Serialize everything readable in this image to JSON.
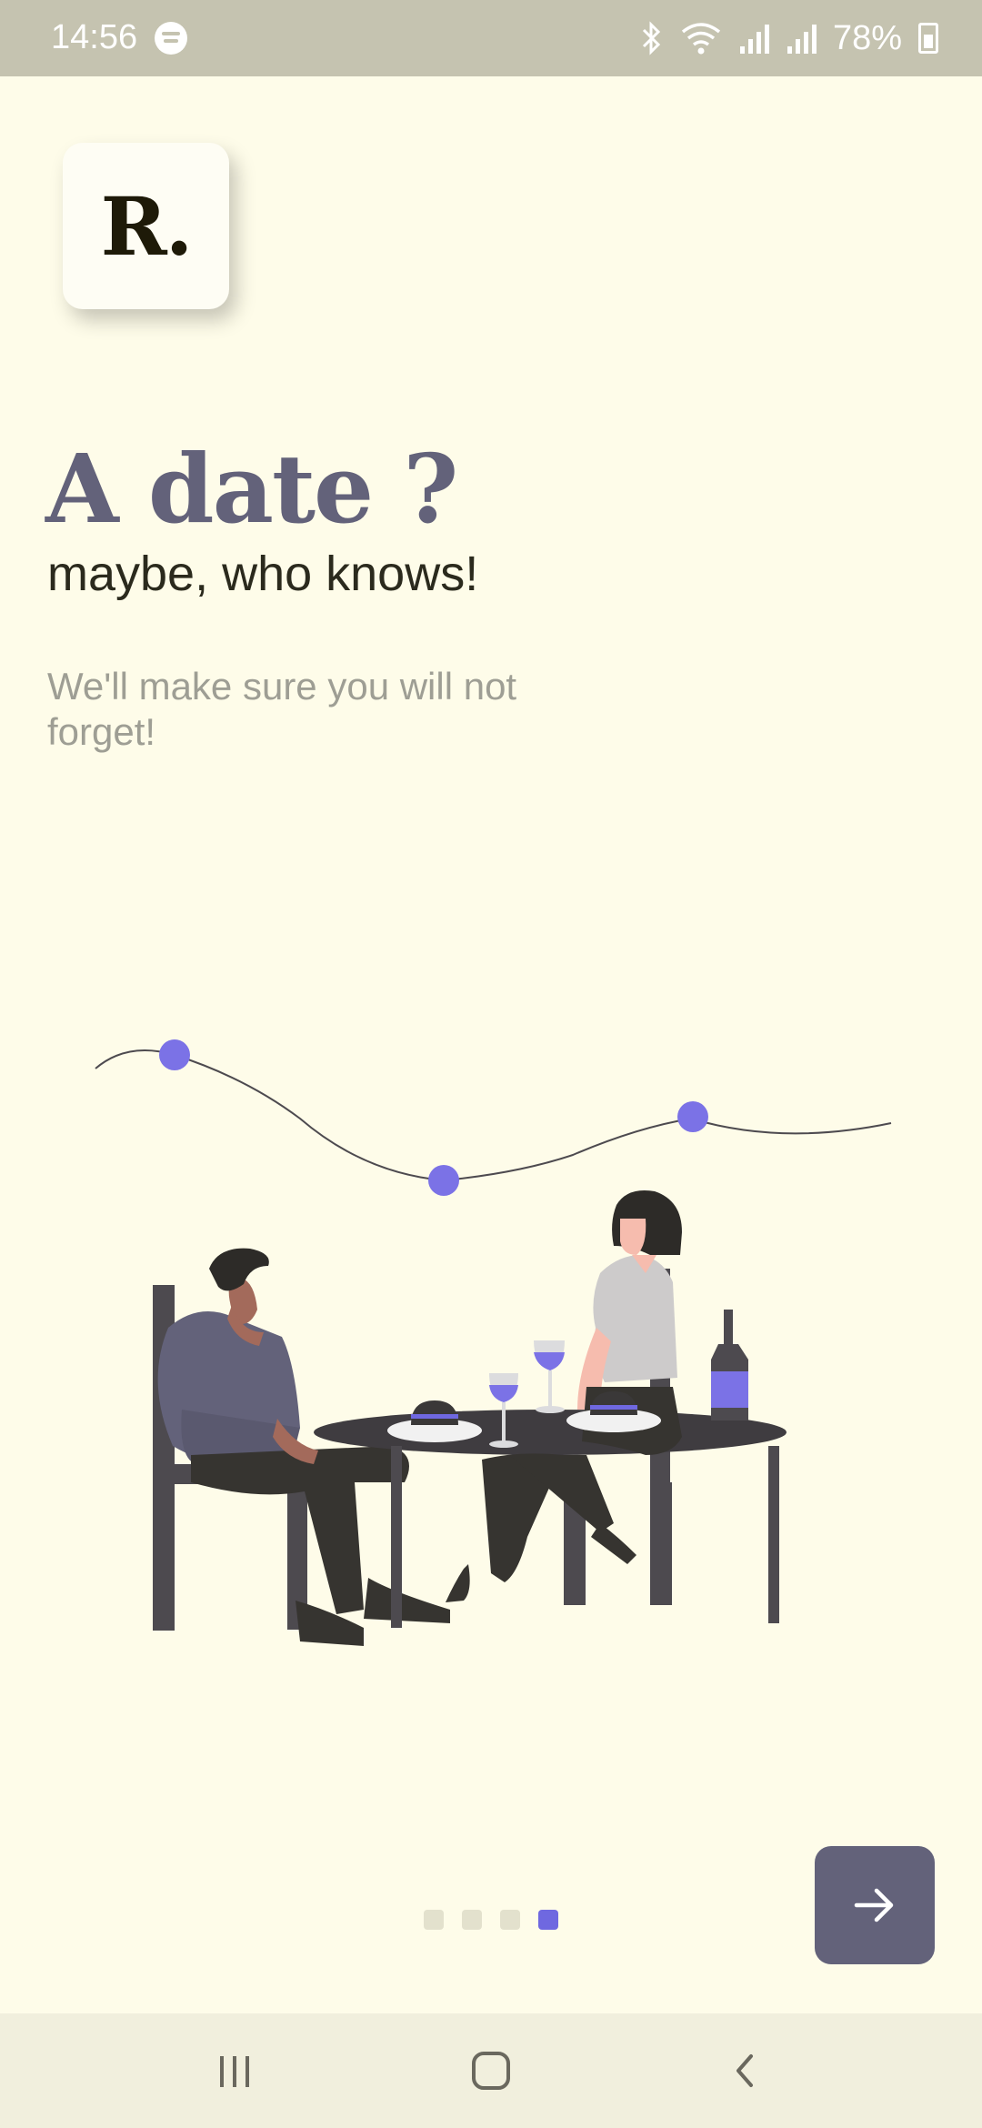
{
  "status_bar": {
    "time": "14:56",
    "battery": "78%",
    "icons": [
      "spotify-icon",
      "bluetooth-icon",
      "wifi-icon",
      "signal-icon",
      "signal-icon",
      "battery-charging-icon"
    ]
  },
  "logo": {
    "text": "R."
  },
  "onboarding": {
    "title": "A date ?",
    "subtitle": "maybe, who knows!",
    "description": "We'll make sure you will not forget!"
  },
  "pagination": {
    "total": 4,
    "current": 4
  },
  "next_button": {
    "icon": "arrow-right-icon"
  },
  "nav_bar": {
    "buttons": [
      "recent-apps-icon",
      "home-icon",
      "back-icon"
    ]
  },
  "colors": {
    "background": "#fefce9",
    "accent": "#6f68e0",
    "title": "#63627a",
    "button": "#63627a"
  }
}
